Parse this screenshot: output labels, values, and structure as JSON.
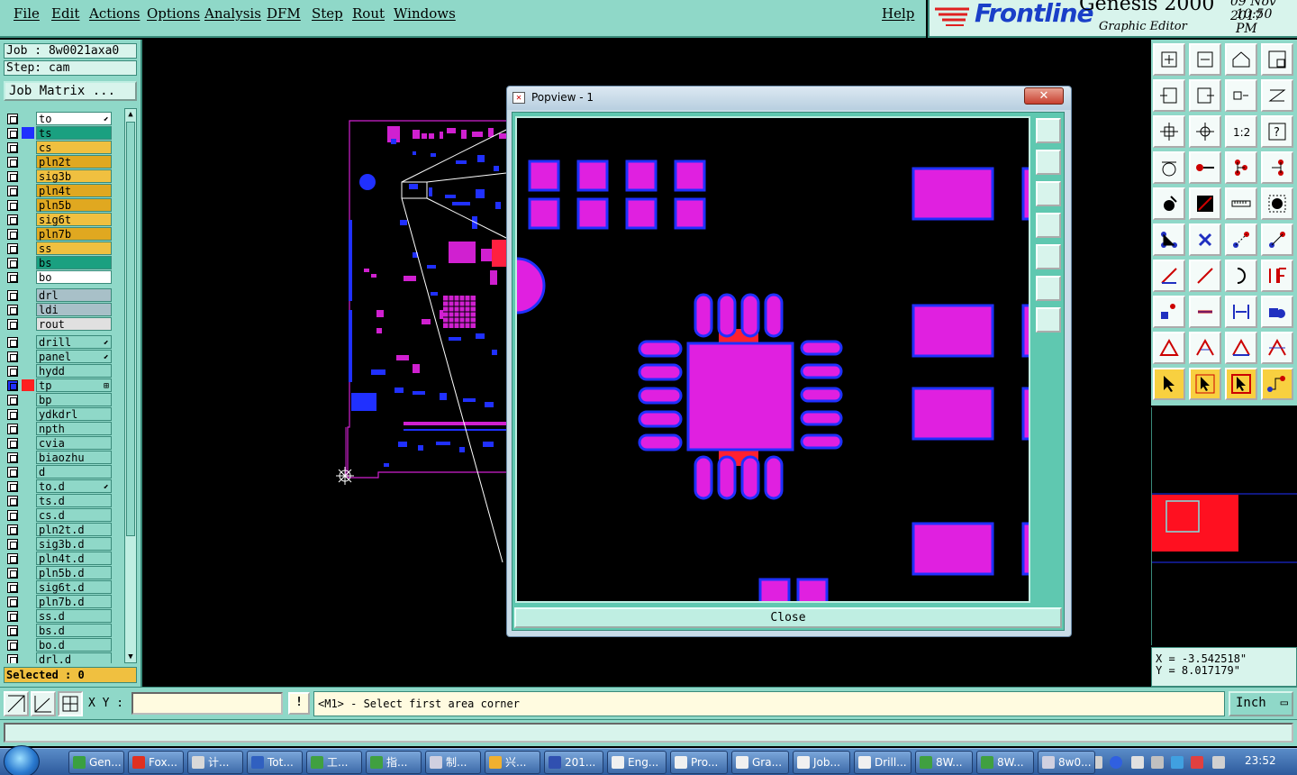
{
  "menubar": {
    "items": [
      "File",
      "Edit",
      "Actions",
      "Options",
      "Analysis",
      "DFM",
      "Step",
      "Rout",
      "Windows"
    ],
    "help": "Help"
  },
  "brand": {
    "logo": "Frontline",
    "product": "Genesis 2000",
    "subtitle": "Graphic Editor",
    "date": "09 Nov 2017",
    "time": "10:50 PM"
  },
  "job": {
    "job_label": "Job : 8w0021axa0",
    "step_label": "Step: cam",
    "matrix_button": "Job Matrix ..."
  },
  "layers": [
    {
      "name": "to",
      "color": "#ffffff",
      "swatch": "",
      "flag": "⬋"
    },
    {
      "name": "ts",
      "color": "#1aa080",
      "swatch": "#2030ff",
      "flag": ""
    },
    {
      "name": "cs",
      "color": "#f0c040",
      "swatch": "",
      "flag": ""
    },
    {
      "name": "pln2t",
      "color": "#e0a820",
      "swatch": "",
      "flag": ""
    },
    {
      "name": "sig3b",
      "color": "#f0c040",
      "swatch": "",
      "flag": ""
    },
    {
      "name": "pln4t",
      "color": "#e0a820",
      "swatch": "",
      "flag": ""
    },
    {
      "name": "pln5b",
      "color": "#e0a820",
      "swatch": "",
      "flag": ""
    },
    {
      "name": "sig6t",
      "color": "#f0c040",
      "swatch": "",
      "flag": ""
    },
    {
      "name": "pln7b",
      "color": "#e0a820",
      "swatch": "",
      "flag": ""
    },
    {
      "name": "ss",
      "color": "#f0c040",
      "swatch": "",
      "flag": ""
    },
    {
      "name": "bs",
      "color": "#1aa080",
      "swatch": "",
      "flag": ""
    },
    {
      "name": "bo",
      "color": "#ffffff",
      "swatch": "",
      "flag": ""
    },
    {
      "name": "drl",
      "color": "#a8c0c8",
      "swatch": "",
      "flag": "",
      "gap": true
    },
    {
      "name": "ldi",
      "color": "#a8c0c8",
      "swatch": "",
      "flag": ""
    },
    {
      "name": "rout",
      "color": "#e0e0e0",
      "swatch": "",
      "flag": ""
    },
    {
      "name": "drill",
      "color": "#8fd8c8",
      "swatch": "",
      "flag": "⬋",
      "gap": true
    },
    {
      "name": "panel",
      "color": "#8fd8c8",
      "swatch": "",
      "flag": "⬋"
    },
    {
      "name": "hydd",
      "color": "#8fd8c8",
      "swatch": "",
      "flag": ""
    },
    {
      "name": "tp",
      "color": "#8fd8c8",
      "swatch": "#ff2020",
      "flag": "⊞",
      "active": true
    },
    {
      "name": "bp",
      "color": "#8fd8c8",
      "swatch": "",
      "flag": ""
    },
    {
      "name": "ydkdrl",
      "color": "#8fd8c8",
      "swatch": "",
      "flag": ""
    },
    {
      "name": "npth",
      "color": "#8fd8c8",
      "swatch": "",
      "flag": ""
    },
    {
      "name": "cvia",
      "color": "#8fd8c8",
      "swatch": "",
      "flag": ""
    },
    {
      "name": "biaozhu",
      "color": "#8fd8c8",
      "swatch": "",
      "flag": ""
    },
    {
      "name": "d",
      "color": "#8fd8c8",
      "swatch": "",
      "flag": ""
    },
    {
      "name": "to.d",
      "color": "#8fd8c8",
      "swatch": "",
      "flag": "⬋"
    },
    {
      "name": "ts.d",
      "color": "#8fd8c8",
      "swatch": "",
      "flag": ""
    },
    {
      "name": "cs.d",
      "color": "#8fd8c8",
      "swatch": "",
      "flag": ""
    },
    {
      "name": "pln2t.d",
      "color": "#8fd8c8",
      "swatch": "",
      "flag": ""
    },
    {
      "name": "sig3b.d",
      "color": "#8fd8c8",
      "swatch": "",
      "flag": ""
    },
    {
      "name": "pln4t.d",
      "color": "#8fd8c8",
      "swatch": "",
      "flag": ""
    },
    {
      "name": "pln5b.d",
      "color": "#8fd8c8",
      "swatch": "",
      "flag": ""
    },
    {
      "name": "sig6t.d",
      "color": "#8fd8c8",
      "swatch": "",
      "flag": ""
    },
    {
      "name": "pln7b.d",
      "color": "#8fd8c8",
      "swatch": "",
      "flag": ""
    },
    {
      "name": "ss.d",
      "color": "#8fd8c8",
      "swatch": "",
      "flag": ""
    },
    {
      "name": "bs.d",
      "color": "#8fd8c8",
      "swatch": "",
      "flag": ""
    },
    {
      "name": "bo.d",
      "color": "#8fd8c8",
      "swatch": "",
      "flag": ""
    },
    {
      "name": "drl.d",
      "color": "#8fd8c8",
      "swatch": "",
      "flag": ""
    }
  ],
  "selected": "Selected : 0",
  "popview": {
    "title": "Popview - 1",
    "close_x": "✕",
    "close_button": "Close"
  },
  "coords": {
    "x": "X = -3.542518\"",
    "y": "Y = 8.017179\""
  },
  "cmdbar": {
    "xy_label": "X Y :",
    "xy_value": "",
    "warn": "!",
    "prompt": "<M1> - Select first area corner",
    "units": "Inch"
  },
  "taskbar": {
    "tasks": [
      {
        "label": "Gen...",
        "icon": "#3aa040"
      },
      {
        "label": "Fox...",
        "icon": "#e03020"
      },
      {
        "label": "计...",
        "icon": "#d8d8d8"
      },
      {
        "label": "Tot...",
        "icon": "#3060c0"
      },
      {
        "label": "工...",
        "icon": "#40a040"
      },
      {
        "label": "指...",
        "icon": "#40a040"
      },
      {
        "label": "制...",
        "icon": "#d0d0e0"
      },
      {
        "label": "兴...",
        "icon": "#f0b030"
      },
      {
        "label": "201...",
        "icon": "#3050b0"
      },
      {
        "label": "Eng...",
        "icon": "#f0f0f0"
      },
      {
        "label": "Pro...",
        "icon": "#f0f0f0"
      },
      {
        "label": "Gra...",
        "icon": "#f0f0f0"
      },
      {
        "label": "Job...",
        "icon": "#f0f0f0"
      },
      {
        "label": "Drill...",
        "icon": "#f0f0f0"
      },
      {
        "label": "8W...",
        "icon": "#40a040"
      },
      {
        "label": "8W...",
        "icon": "#40a040"
      },
      {
        "label": "8w0...",
        "icon": "#d0d0e0"
      }
    ],
    "clock": "23:52"
  }
}
